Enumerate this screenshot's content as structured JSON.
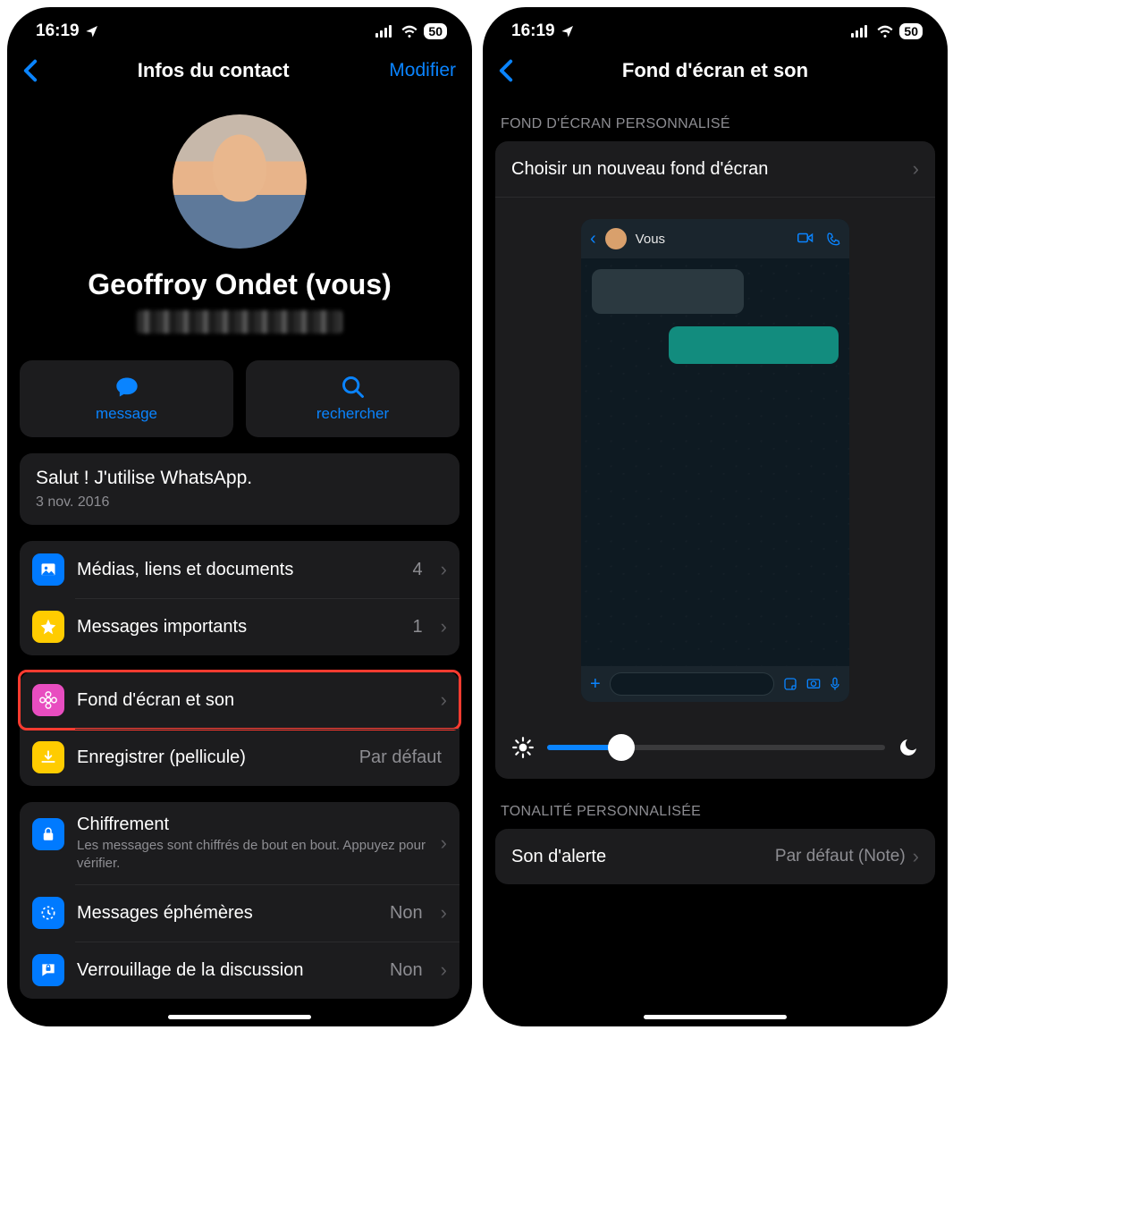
{
  "status": {
    "time": "16:19",
    "battery": "50"
  },
  "screen1": {
    "nav": {
      "title": "Infos du contact",
      "edit": "Modifier"
    },
    "contact_name": "Geoffroy Ondet (vous)",
    "actions": {
      "message": "message",
      "search": "rechercher"
    },
    "about": {
      "text": "Salut ! J'utilise WhatsApp.",
      "date": "3 nov. 2016"
    },
    "media_row": {
      "label": "Médias, liens et documents",
      "count": "4"
    },
    "starred_row": {
      "label": "Messages importants",
      "count": "1"
    },
    "wallpaper_row": {
      "label": "Fond d'écran et son"
    },
    "save_row": {
      "label": "Enregistrer (pellicule)",
      "value": "Par défaut"
    },
    "encryption": {
      "label": "Chiffrement",
      "sub": "Les messages sont chiffrés de bout en bout. Appuyez pour vérifier."
    },
    "disappearing": {
      "label": "Messages éphémères",
      "value": "Non"
    },
    "chatlock": {
      "label": "Verrouillage de la discussion",
      "value": "Non"
    }
  },
  "screen2": {
    "nav_title": "Fond d'écran et son",
    "section1": "FOND D'ÉCRAN PERSONNALISÉ",
    "choose_label": "Choisir un nouveau fond d'écran",
    "preview_name": "Vous",
    "brightness_pct": 22,
    "section2": "TONALITÉ PERSONNALISÉE",
    "alert_row": {
      "label": "Son d'alerte",
      "value": "Par défaut (Note)"
    }
  }
}
